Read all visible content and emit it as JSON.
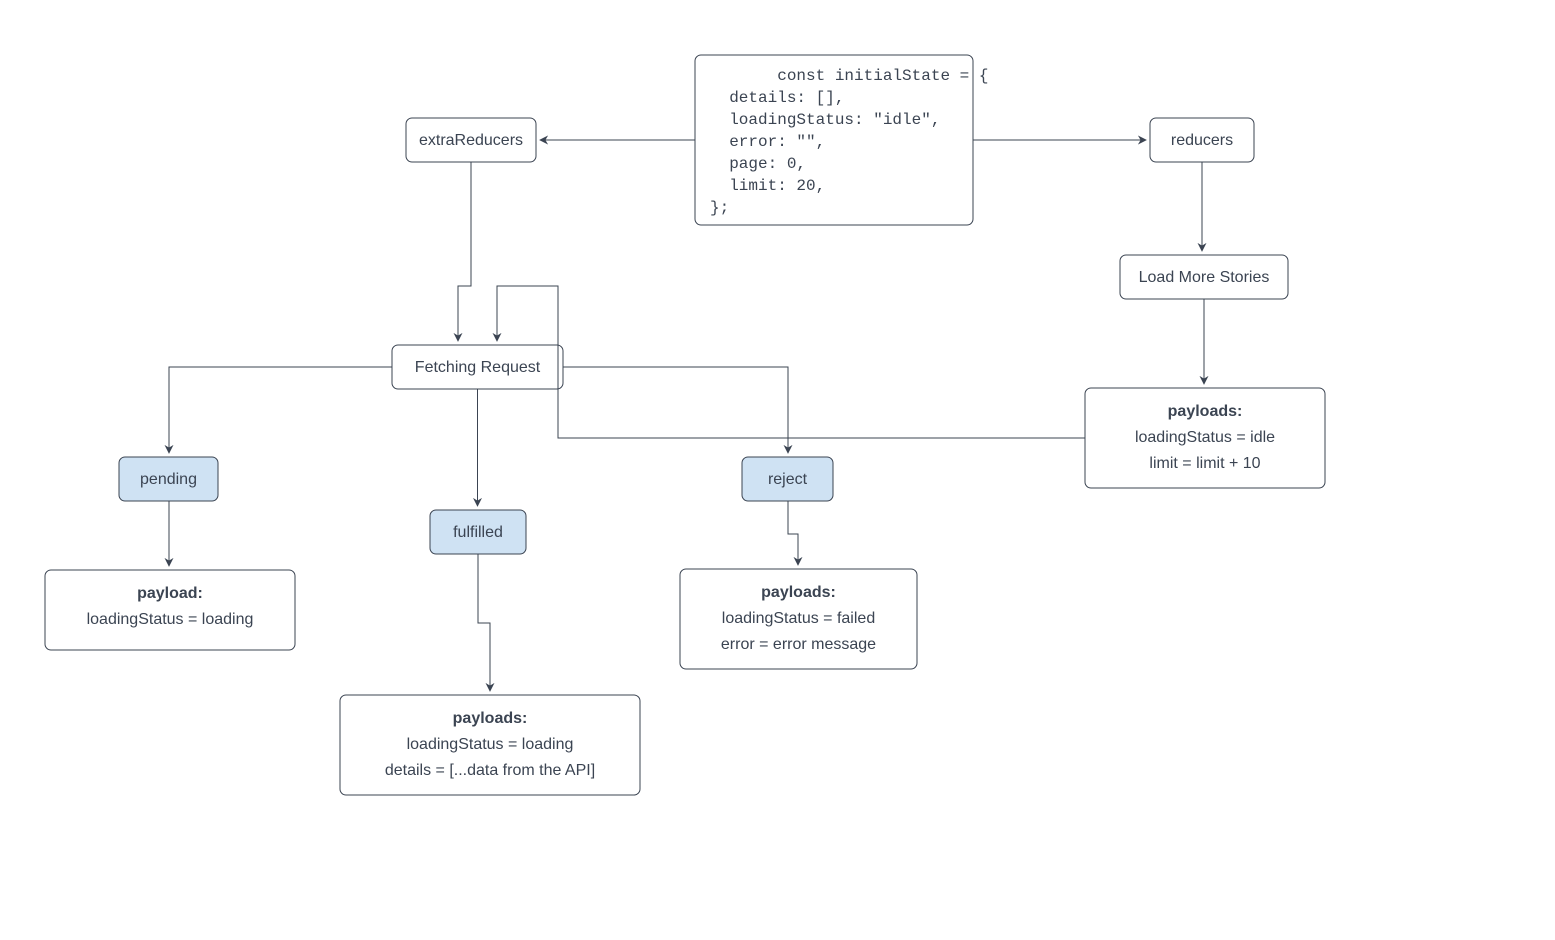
{
  "nodes": {
    "extraReducers": "extraReducers",
    "reducers": "reducers",
    "initialState": {
      "l1a": "const ",
      "l1b": "initialState",
      "l1c": " = {",
      "l2": "  details: [],",
      "l3": "  loadingStatus: \"idle\",",
      "l4": "  error: \"\",",
      "l5": "  page: 0,",
      "l6": "  limit: 20,",
      "l7": "};"
    },
    "fetching": "Fetching Request",
    "pending": "pending",
    "fulfilled": "fulfilled",
    "reject": "reject",
    "loadMore": "Load More Stories",
    "payloadPending": {
      "title": "payload:",
      "l1": "loadingStatus = loading"
    },
    "payloadFulfilled": {
      "title": "payloads:",
      "l1": "loadingStatus = loading",
      "l2": "details = [...data from the API]"
    },
    "payloadReject": {
      "title": "payloads:",
      "l1": "loadingStatus = failed",
      "l2": "error = error message"
    },
    "payloadLoadMore": {
      "title": "payloads:",
      "l1": "loadingStatus  = idle",
      "l2": "limit = limit + 10"
    }
  }
}
